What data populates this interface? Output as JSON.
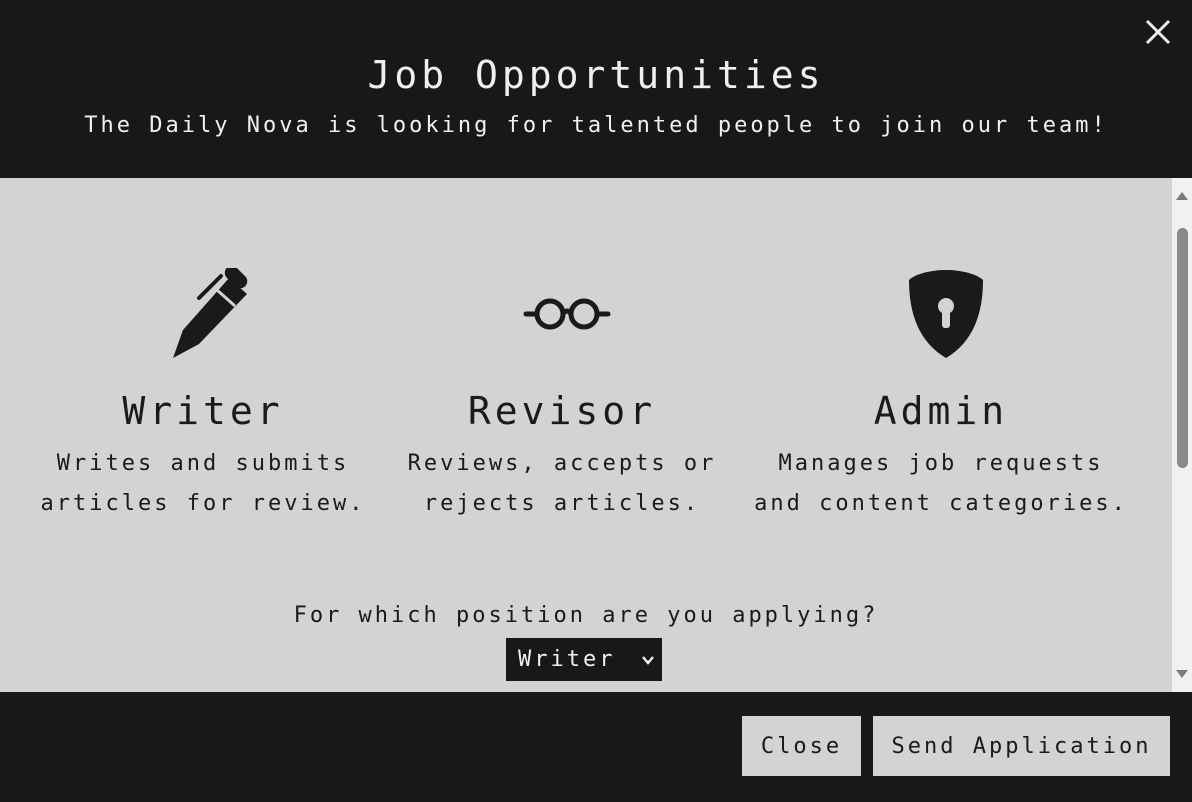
{
  "header": {
    "title": "Job Opportunities",
    "subtitle": "The Daily Nova is looking for talented people to join our team!"
  },
  "roles": [
    {
      "icon": "pen-icon",
      "name": "Writer",
      "description_line1": "Writes and submits",
      "description_line2": "articles for review."
    },
    {
      "icon": "glasses-icon",
      "name": "Revisor",
      "description_line1": "Reviews, accepts or",
      "description_line2": "rejects articles."
    },
    {
      "icon": "shield-keyhole-icon",
      "name": "Admin",
      "description_line1": "Manages job requests",
      "description_line2": "and content categories."
    }
  ],
  "form": {
    "question": "For which position are you applying?",
    "position_select": {
      "selected": "Writer",
      "options": [
        "Writer",
        "Revisor",
        "Admin"
      ]
    }
  },
  "footer": {
    "close_label": "Close",
    "send_label": "Send Application"
  },
  "colors": {
    "dark": "#181818",
    "panel": "#d3d3d3",
    "text_light": "#f0f0f0",
    "text_dark": "#1a1a1a"
  }
}
